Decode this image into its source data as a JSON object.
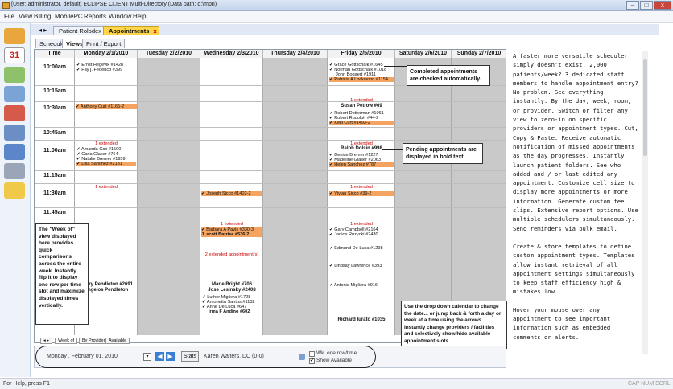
{
  "window": {
    "title": "[User: administrator, default] ECLIPSE CLIENT Multi-Directory (Data path: d:\\mpn)",
    "min": "–",
    "max": "□",
    "close": "x"
  },
  "menu": [
    "File",
    "View",
    "Billing",
    "MobilePC",
    "Reports",
    "Window",
    "Help"
  ],
  "doc_tabs": {
    "rolodex": "Patient Rolodex",
    "appointments": "Appointments",
    "close": "x"
  },
  "sub_tabs": [
    "Schedule",
    "Views",
    "Print / Export"
  ],
  "grid": {
    "headers": [
      "Time",
      "Monday 2/1/2010",
      "Tuesday 2/2/2010",
      "Wednesday 2/3/2010",
      "Thursday 2/4/2010",
      "Friday 2/5/2010",
      "Saturday 2/6/2010",
      "Sunday 2/7/2010"
    ],
    "times": [
      "10:00am",
      "10:15am",
      "10:30am",
      "10:45am",
      "11:00am",
      "11:15am",
      "11:30am",
      "11:45am"
    ],
    "monday": {
      "a1": "✔ Ernst Hegevik #1428",
      "a2": "✔ Fay j. Federico #399",
      "a3": "✔ Anthony Curt #1165-2",
      "ext1": "1 extended",
      "a4": "✔ Amanda Cox #1500",
      "a5": "✔ Carla Glaser #764",
      "a6": "✔ Natalie Bremer #1959",
      "a7": "✔ Lisa Sanchez #2131",
      "ext2": "1 extended",
      "b1": "Henry Pendleton #2691",
      "b2": "Angelos Pendleton"
    },
    "wednesday": {
      "a1": "✔ Joseph Sicco #1402-2",
      "ext1": "1 extended",
      "a2": "✔ Barbara A Pavis #330-3",
      "a3": "J. scott Barrise #536-2",
      "ext2": "2 extended appointment(s)",
      "b1": "Marie Bright #706",
      "b2": "Jose Lesinsky #2408",
      "c1": "✔ Luther Migliera #1728",
      "c2": "✔ Antonetta Santos #1132",
      "c3": "✔ Anne De Luca #647",
      "c4": "Irma F Andino #602"
    },
    "friday": {
      "a1": "✔ Grace Gottschalk #1645",
      "a2": "✔ Norman Gottschalk #1018",
      "a3": "John Bogaert #1911",
      "a4": "✔ Patricia A Lockwood #1154",
      "ext1": "1 extended",
      "b1": "Susan Petrow #69",
      "c1": "✔ Robert Dotterman #1061",
      "c2": "✔ Robert Rudolph #44-2",
      "c3": "✔ Kelli Curt #1493-2",
      "ext2": "1 extended",
      "b2": "Ralph Dolsin #998",
      "c4": "✔ Denise Bremer #1227",
      "c5": "✔ Madeline Glaser #2063",
      "c6": "✔ Helen Sanchez #787",
      "ext3": "1 extended",
      "c7": "✔ Vivian Sicco #39-2",
      "ext4": "1 extended",
      "c8": "✔ Gary Campbell #2164",
      "c9": "✔ Janice Ruzycki #2430",
      "c10": "✔ Edmund De Luca #1298",
      "c11": "✔ Lindsay Lawrence #393",
      "c12": "✔ Antonia Migliera #916",
      "b3": "Richard Iurato #1035"
    }
  },
  "callouts": {
    "completed": "Completed appointments are checked automatically.",
    "pending": "Pending appointments are displayed in bold text.",
    "weekof": "The \"Week of\" view displayed here provides quick comparisons across the entire week. Instantly flip it to display one row per time slot and maximize displayed times vertically.",
    "calendar": "Use the drop down calendar to change the date... or jump back & forth a day or week at a time using the arrows. Instantly change providers / facilities and selectively show/hide available appointment slots."
  },
  "bottom_tabs": [
    "Week of",
    "By Provider",
    "Available"
  ],
  "controls": {
    "date": "Monday , February 01, 2010",
    "stats": "Stats",
    "provider": "Karen Walters, DC (0-0)",
    "wk_label": "Wk. one row/time",
    "show_label": "Show Available",
    "wk_checked": false,
    "show_checked": true
  },
  "right_panel": {
    "p1": "A faster more versatile scheduler simply doesn't exist. 2,000 patients/week? 3 dedicated staff members to handle appointment entry? No problem. See everything instantly. By the day, week, room, or provider. Switch or filter any view to zero-in on specific providers or appointment types. Cut, Copy & Paste. Receive automatic notification of missed appointments as the day progresses. Instantly launch patient folders. See who added and / or last edited any appointment. Customize cell size to display more appointments or more information. Generate custom fee slips. Extensive report options. Use multiple schedulers simultaneously. Send reminders via bulk email.",
    "p2": "Create & store templates to define custom appointment types. Templates allow instant retrieval of all appointment settings simultaneously to keep staff efficiency high & mistakes low.",
    "p3": "Hover your mouse over any appointment to see important information such as embedded comments or alerts."
  },
  "status": {
    "left": "For Help, press F1",
    "right": "CAP NUM SCRL"
  },
  "colors": {
    "highlight": "#f4a460",
    "gray_cell": "#c9c9c9",
    "accent_tab": "#ffd54a"
  }
}
